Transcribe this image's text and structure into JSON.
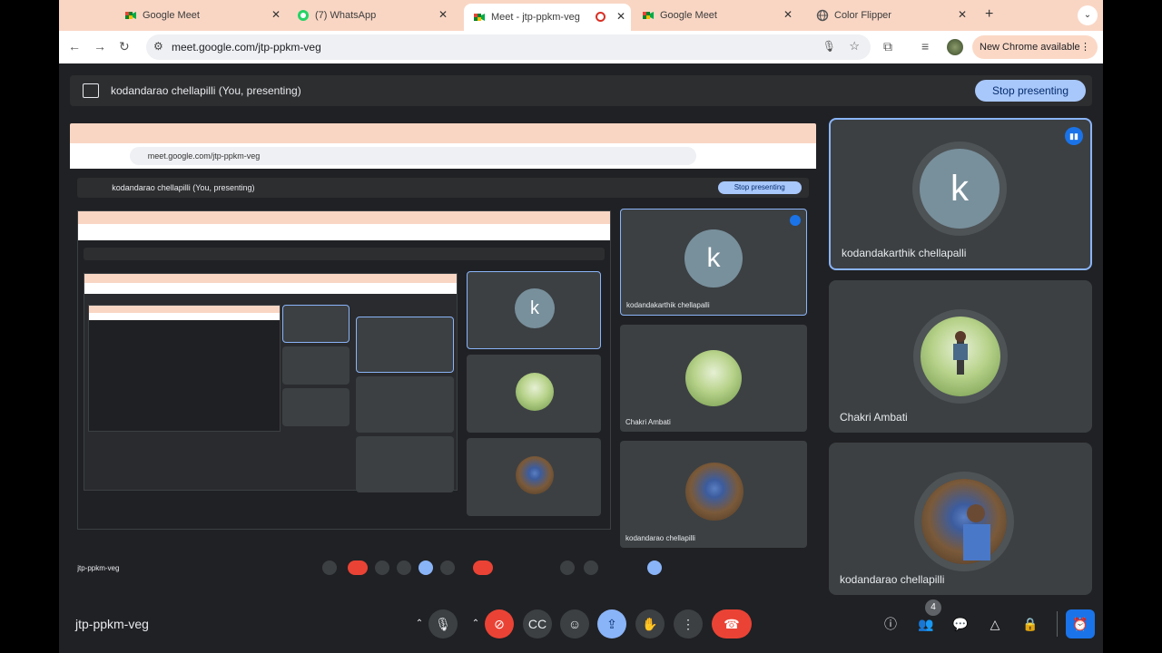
{
  "browser": {
    "tabs": [
      {
        "title": "Google Meet",
        "favicon": "meet-icon"
      },
      {
        "title": "(7) WhatsApp",
        "favicon": "whatsapp-icon"
      },
      {
        "title": "Meet - jtp-ppkm-veg",
        "favicon": "meet-icon",
        "active": true
      },
      {
        "title": "Google Meet",
        "favicon": "meet-icon"
      },
      {
        "title": "Color Flipper",
        "favicon": "globe-icon"
      }
    ],
    "url": "meet.google.com/jtp-ppkm-veg",
    "new_chrome_label": "New Chrome available"
  },
  "meeting": {
    "presenting_label": "kodandarao chellapilli (You, presenting)",
    "stop_label": "Stop presenting",
    "code": "jtp-ppkm-veg",
    "participant_count": "4"
  },
  "participants": [
    {
      "name": "kodandakarthik chellapalli",
      "avatar": "k",
      "speaking": true
    },
    {
      "name": "Chakri Ambati",
      "avatar": "photo"
    },
    {
      "name": "kodandarao chellapilli",
      "avatar": "photo"
    }
  ],
  "colors": {
    "accent": "#8ab4f8",
    "danger": "#ea4335",
    "surface": "#202124",
    "tile": "#3c4043",
    "tab_strip": "#f9d6c4"
  },
  "icons": {
    "mic": "mic-icon",
    "camera_off": "camera-off-icon",
    "captions": "captions-icon",
    "emoji": "emoji-icon",
    "present": "present-icon",
    "hand": "raise-hand-icon",
    "more": "more-options-icon",
    "hangup": "hang-up-icon",
    "info": "info-icon",
    "people": "people-icon",
    "chat": "chat-icon",
    "activities": "activities-icon",
    "host": "host-controls-icon",
    "timer": "timer-icon"
  }
}
